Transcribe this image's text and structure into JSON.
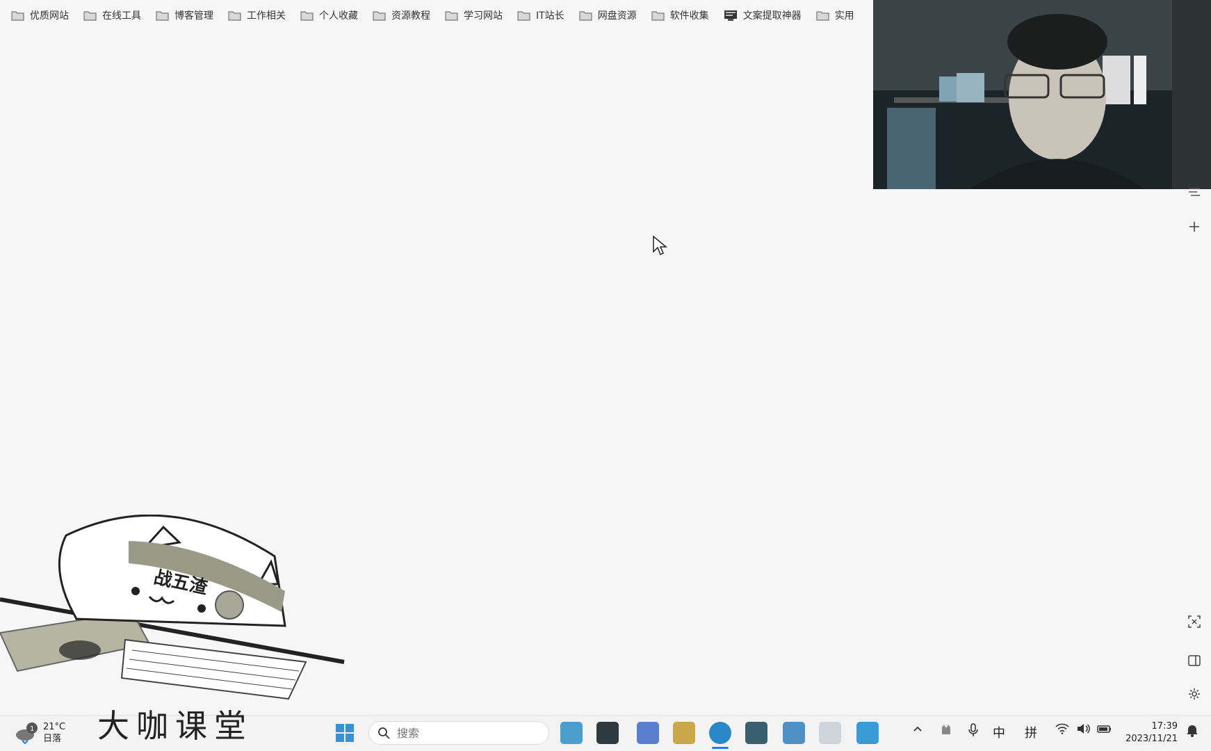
{
  "bookmarks": [
    {
      "label": "优质网站",
      "icon": "folder-icon"
    },
    {
      "label": "在线工具",
      "icon": "folder-icon"
    },
    {
      "label": "博客管理",
      "icon": "folder-icon"
    },
    {
      "label": "工作相关",
      "icon": "folder-icon"
    },
    {
      "label": "个人收藏",
      "icon": "folder-icon"
    },
    {
      "label": "资源教程",
      "icon": "folder-icon"
    },
    {
      "label": "学习网站",
      "icon": "folder-icon"
    },
    {
      "label": "IT站长",
      "icon": "folder-icon"
    },
    {
      "label": "网盘资源",
      "icon": "folder-icon"
    },
    {
      "label": "软件收集",
      "icon": "folder-icon"
    },
    {
      "label": "文案提取神器",
      "icon": "page-icon"
    },
    {
      "label": "实用",
      "icon": "folder-icon"
    }
  ],
  "mascot": {
    "headband_text": "战五渣"
  },
  "taskbar": {
    "weather": {
      "temp": "21°C",
      "condition": "日落",
      "badge": "1"
    },
    "logo_text": "大咖课堂",
    "search_placeholder": "搜索",
    "tray": {
      "ime_lang": "中",
      "ime_mode": "拼"
    },
    "clock": {
      "time": "17:39",
      "date": "2023/11/21"
    }
  },
  "colors": {
    "accent": "#1a73e8",
    "taskbar_bg": "#f3f3f3",
    "page_bg": "#f6f6f6"
  }
}
